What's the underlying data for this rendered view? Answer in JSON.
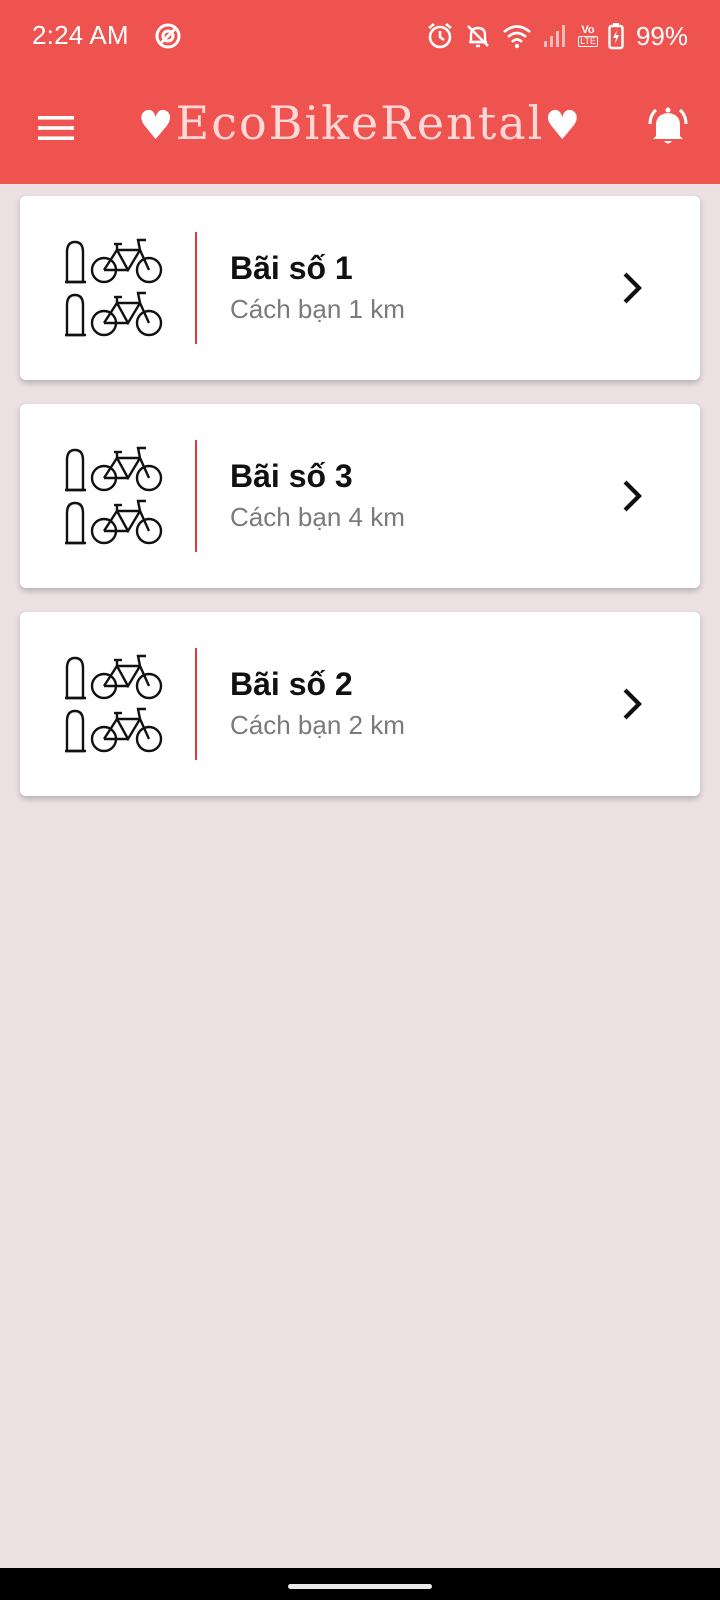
{
  "status_bar": {
    "time": "2:24 AM",
    "battery": "99%",
    "network_badge_top": "Vo",
    "network_badge_bottom": "LTE",
    "icons": [
      "cast-icon",
      "alarm-icon",
      "notifications-off-icon",
      "wifi-icon",
      "cellular-signal-icon",
      "volte-icon",
      "battery-charging-icon"
    ]
  },
  "app_bar": {
    "title": "EcoBikeRental",
    "title_decoration": "♥",
    "menu_icon": "menu-icon",
    "bell_icon": "notification-bell-icon",
    "background_color": "#ef5350"
  },
  "parking_lots": [
    {
      "name": "Bãi số 1",
      "distance": "Cách bạn 1 km"
    },
    {
      "name": "Bãi số 3",
      "distance": "Cách bạn 4 km"
    },
    {
      "name": "Bãi số 2",
      "distance": "Cách bạn 2 km"
    }
  ],
  "colors": {
    "accent": "#ef5350",
    "divider": "#e53935",
    "background": "#ebe1e2"
  }
}
